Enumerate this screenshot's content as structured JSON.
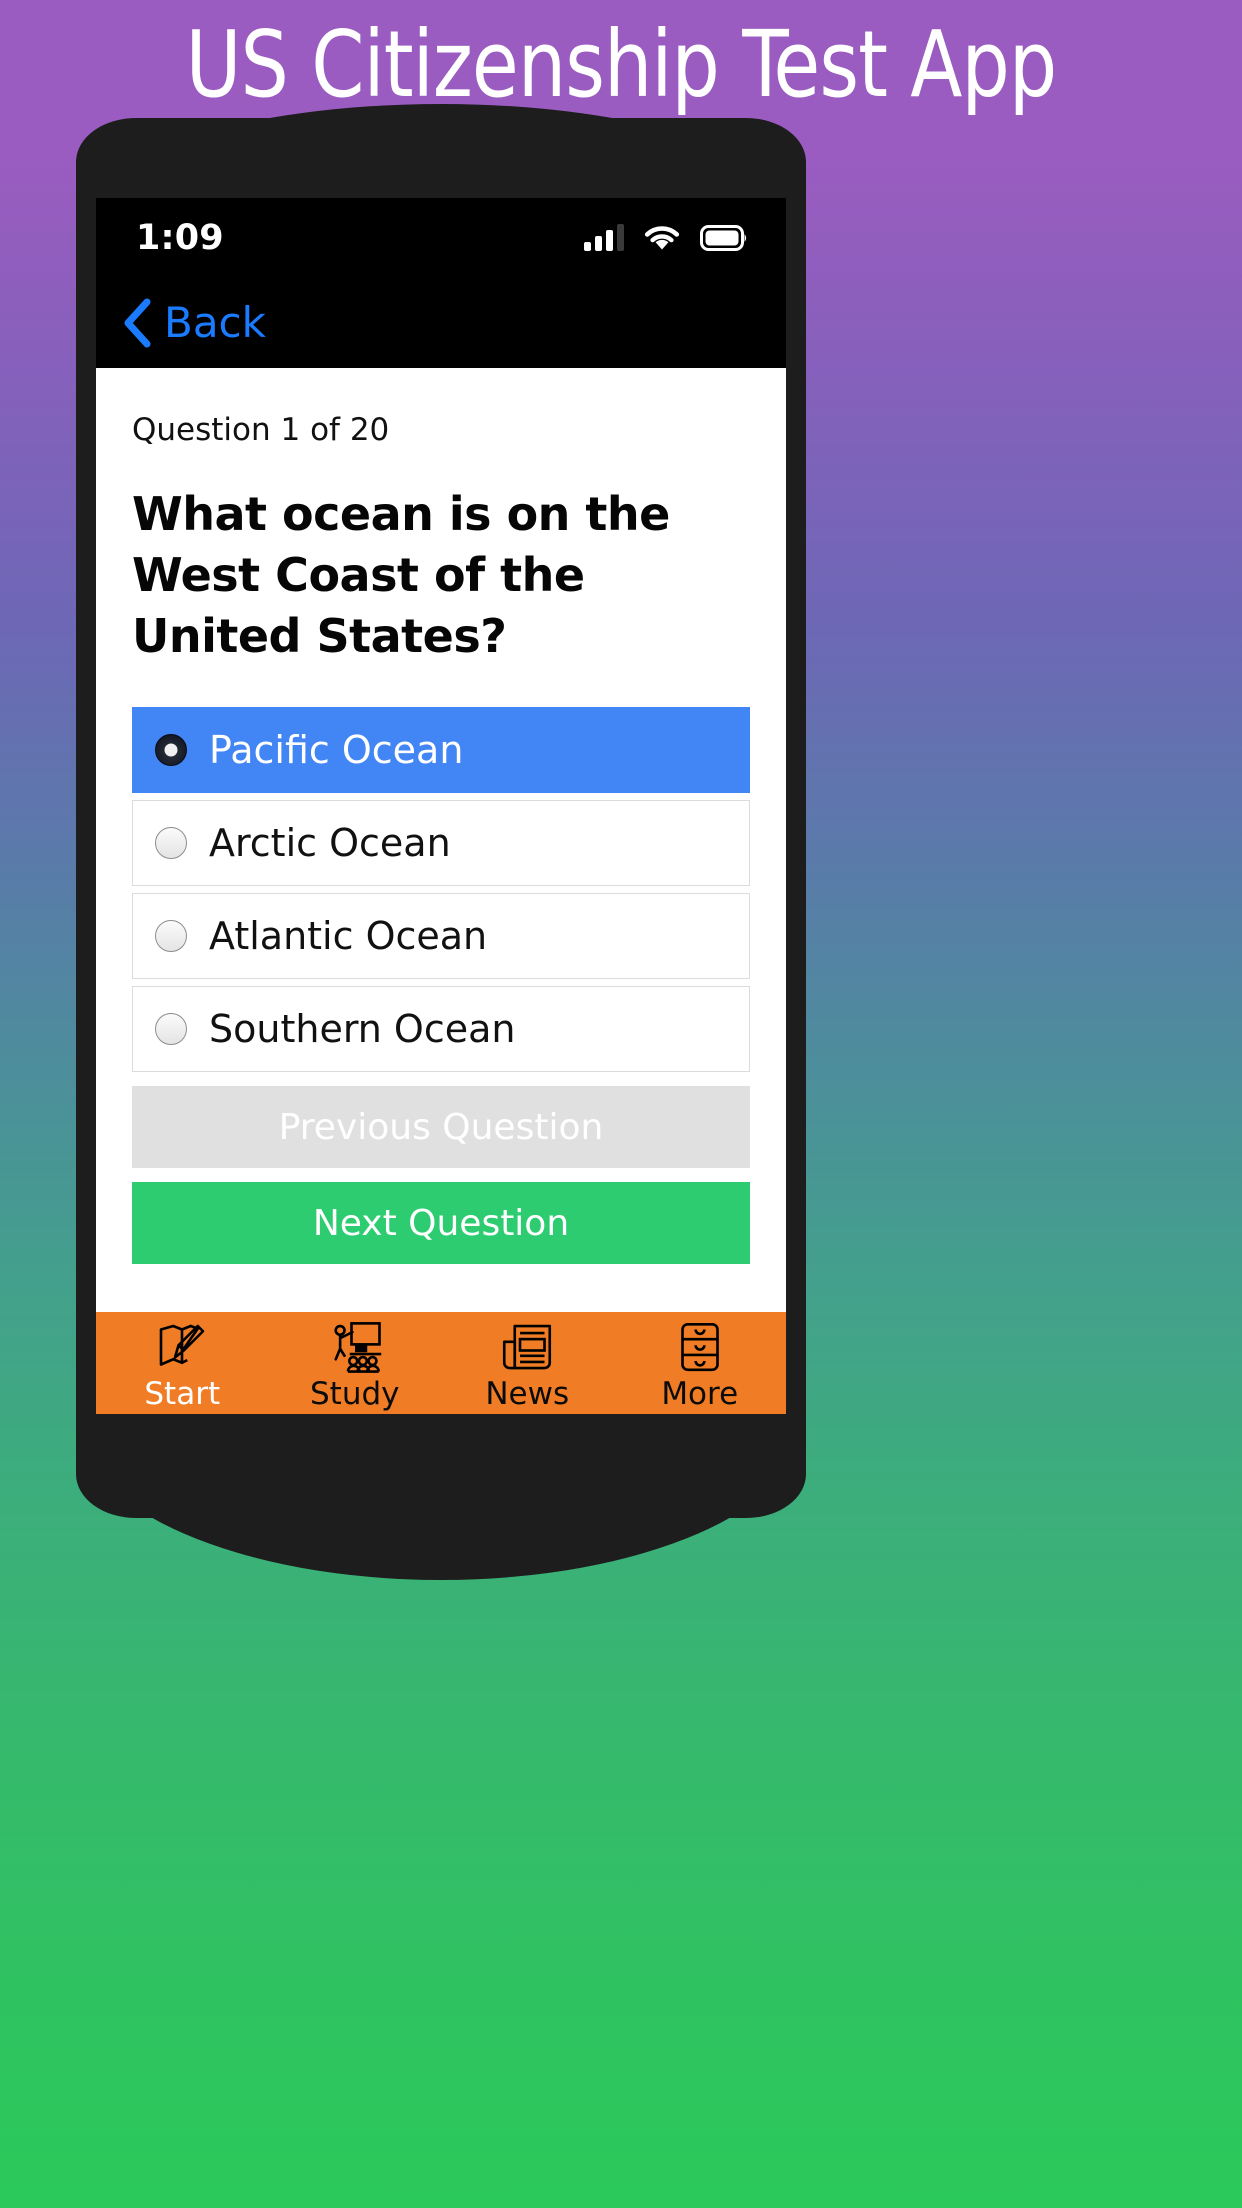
{
  "page": {
    "heading": "US Citizenship Test App",
    "background_top_color": "#9a5cc0",
    "background_bottom_color": "#2bc95b"
  },
  "status_bar": {
    "time": "1:09",
    "icons": [
      "signal-bars-icon",
      "wifi-icon",
      "battery-icon"
    ]
  },
  "nav_bar": {
    "back_label": "Back",
    "back_icon": "chevron-left-icon",
    "accent_color": "#1a7bff"
  },
  "quiz": {
    "counter": "Question 1 of 20",
    "question": "What ocean is on the West Coast of the United States?",
    "selected_color": "#4285f4",
    "options": [
      {
        "label": "Pacific Ocean",
        "selected": true
      },
      {
        "label": "Arctic Ocean",
        "selected": false
      },
      {
        "label": "Atlantic Ocean",
        "selected": false
      },
      {
        "label": "Southern Ocean",
        "selected": false
      }
    ],
    "previous_label": "Previous Question",
    "previous_enabled": false,
    "previous_color": "#e0e0e0",
    "next_label": "Next Question",
    "next_color": "#2ecc71"
  },
  "tab_bar": {
    "background_color": "#f07d25",
    "items": [
      {
        "label": "Start",
        "icon": "map-pencil-icon",
        "active": true
      },
      {
        "label": "Study",
        "icon": "classroom-icon",
        "active": false
      },
      {
        "label": "News",
        "icon": "newspaper-icon",
        "active": false
      },
      {
        "label": "More",
        "icon": "file-drawers-icon",
        "active": false
      }
    ]
  }
}
